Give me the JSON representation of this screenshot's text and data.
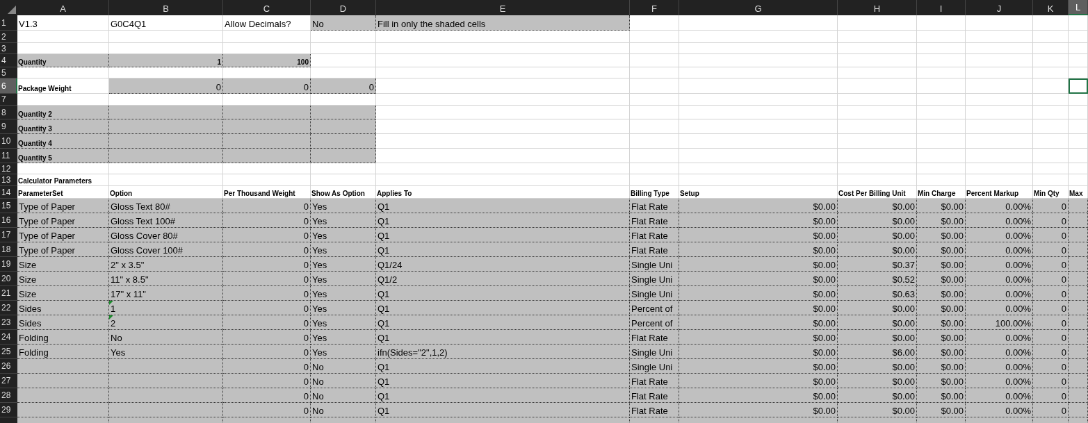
{
  "columns": [
    {
      "label": "A",
      "selected": false
    },
    {
      "label": "B",
      "selected": false
    },
    {
      "label": "C",
      "selected": false
    },
    {
      "label": "D",
      "selected": false
    },
    {
      "label": "E",
      "selected": false
    },
    {
      "label": "F",
      "selected": false
    },
    {
      "label": "G",
      "selected": false
    },
    {
      "label": "H",
      "selected": false
    },
    {
      "label": "I",
      "selected": false
    },
    {
      "label": "J",
      "selected": false
    },
    {
      "label": "K",
      "selected": false
    },
    {
      "label": "L",
      "selected": true
    }
  ],
  "rows": [
    {
      "number": "1",
      "selected": false,
      "cells": [
        {
          "text": "V1.3",
          "kind": "text",
          "shaded": false
        },
        {
          "text": "G0C4Q1",
          "kind": "text",
          "shaded": false,
          "flagged": false
        },
        {
          "text": "Allow Decimals?",
          "kind": "text",
          "shaded": false
        },
        {
          "text": "No",
          "kind": "text",
          "shaded": true
        },
        {
          "text": "Fill in only the shaded cells",
          "kind": "text",
          "shaded": true
        },
        {
          "shaded": false
        },
        {
          "shaded": false
        },
        {
          "shaded": false
        },
        {
          "shaded": false
        },
        {
          "shaded": false
        },
        {
          "shaded": false
        },
        {
          "shaded": false
        }
      ]
    },
    {
      "number": "2",
      "selected": false,
      "cells": [
        {
          "shaded": false
        },
        {
          "shaded": false
        },
        {
          "shaded": false
        },
        {
          "shaded": false
        },
        {
          "shaded": false
        },
        {
          "shaded": false
        },
        {
          "shaded": false
        },
        {
          "shaded": false
        },
        {
          "shaded": false
        },
        {
          "shaded": false
        },
        {
          "shaded": false
        },
        {
          "shaded": false
        }
      ]
    },
    {
      "number": "3",
      "selected": false,
      "cells": [
        {
          "shaded": false
        },
        {
          "shaded": false
        },
        {
          "shaded": false
        },
        {
          "shaded": false
        },
        {
          "shaded": false
        },
        {
          "shaded": false
        },
        {
          "shaded": false
        },
        {
          "shaded": false
        },
        {
          "shaded": false
        },
        {
          "shaded": false
        },
        {
          "shaded": false
        },
        {
          "shaded": false
        }
      ]
    },
    {
      "number": "4",
      "selected": false,
      "cells": [
        {
          "text": "Quantity",
          "kind": "label",
          "shaded": true
        },
        {
          "text": "1",
          "kind": "label-number",
          "shaded": true,
          "flagged": false
        },
        {
          "text": "100",
          "kind": "label-number",
          "shaded": true
        },
        {
          "shaded": false
        },
        {
          "shaded": false
        },
        {
          "shaded": false
        },
        {
          "shaded": false
        },
        {
          "shaded": false
        },
        {
          "shaded": false
        },
        {
          "shaded": false
        },
        {
          "shaded": false
        },
        {
          "shaded": false
        }
      ]
    },
    {
      "number": "5",
      "selected": false,
      "cells": [
        {
          "shaded": false
        },
        {
          "shaded": false
        },
        {
          "shaded": false
        },
        {
          "shaded": false
        },
        {
          "shaded": false
        },
        {
          "shaded": false
        },
        {
          "shaded": false
        },
        {
          "shaded": false
        },
        {
          "shaded": false
        },
        {
          "shaded": false
        },
        {
          "shaded": false
        },
        {
          "shaded": false
        }
      ]
    },
    {
      "number": "6",
      "selected": true,
      "cells": [
        {
          "text": "Package Weight",
          "kind": "label",
          "shaded": false
        },
        {
          "text": "0",
          "kind": "number",
          "shaded": true,
          "flagged": false
        },
        {
          "text": "0",
          "kind": "number",
          "shaded": true
        },
        {
          "text": "0",
          "kind": "number",
          "shaded": true
        },
        {
          "shaded": false
        },
        {
          "shaded": false
        },
        {
          "shaded": false
        },
        {
          "shaded": false
        },
        {
          "shaded": false
        },
        {
          "shaded": false
        },
        {
          "shaded": false
        },
        {
          "shaded": false
        }
      ]
    },
    {
      "number": "7",
      "selected": false,
      "cells": [
        {
          "shaded": false
        },
        {
          "shaded": false
        },
        {
          "shaded": false
        },
        {
          "shaded": false
        },
        {
          "shaded": false
        },
        {
          "shaded": false
        },
        {
          "shaded": false
        },
        {
          "shaded": false
        },
        {
          "shaded": false
        },
        {
          "shaded": false
        },
        {
          "shaded": false
        },
        {
          "shaded": false
        }
      ]
    },
    {
      "number": "8",
      "selected": false,
      "cells": [
        {
          "text": "Quantity 2",
          "kind": "label",
          "shaded": true
        },
        {
          "shaded": true
        },
        {
          "shaded": true
        },
        {
          "shaded": true
        },
        {
          "shaded": false
        },
        {
          "shaded": false
        },
        {
          "shaded": false
        },
        {
          "shaded": false
        },
        {
          "shaded": false
        },
        {
          "shaded": false
        },
        {
          "shaded": false
        },
        {
          "shaded": false
        }
      ]
    },
    {
      "number": "9",
      "selected": false,
      "cells": [
        {
          "text": "Quantity 3",
          "kind": "label",
          "shaded": true
        },
        {
          "shaded": true
        },
        {
          "shaded": true
        },
        {
          "shaded": true
        },
        {
          "shaded": false
        },
        {
          "shaded": false
        },
        {
          "shaded": false
        },
        {
          "shaded": false
        },
        {
          "shaded": false
        },
        {
          "shaded": false
        },
        {
          "shaded": false
        },
        {
          "shaded": false
        }
      ]
    },
    {
      "number": "10",
      "selected": false,
      "cells": [
        {
          "text": "Quantity 4",
          "kind": "label",
          "shaded": true
        },
        {
          "shaded": true
        },
        {
          "shaded": true
        },
        {
          "shaded": true
        },
        {
          "shaded": false
        },
        {
          "shaded": false
        },
        {
          "shaded": false
        },
        {
          "shaded": false
        },
        {
          "shaded": false
        },
        {
          "shaded": false
        },
        {
          "shaded": false
        },
        {
          "shaded": false
        }
      ]
    },
    {
      "number": "11",
      "selected": false,
      "cells": [
        {
          "text": "Quantity 5",
          "kind": "label",
          "shaded": true
        },
        {
          "shaded": true
        },
        {
          "shaded": true
        },
        {
          "shaded": true
        },
        {
          "shaded": false
        },
        {
          "shaded": false
        },
        {
          "shaded": false
        },
        {
          "shaded": false
        },
        {
          "shaded": false
        },
        {
          "shaded": false
        },
        {
          "shaded": false
        },
        {
          "shaded": false
        }
      ]
    },
    {
      "number": "12",
      "selected": false,
      "cells": [
        {
          "shaded": false
        },
        {
          "shaded": false
        },
        {
          "shaded": false
        },
        {
          "shaded": false
        },
        {
          "shaded": false
        },
        {
          "shaded": false
        },
        {
          "shaded": false
        },
        {
          "shaded": false
        },
        {
          "shaded": false
        },
        {
          "shaded": false
        },
        {
          "shaded": false
        },
        {
          "shaded": false
        }
      ]
    },
    {
      "number": "13",
      "selected": false,
      "cells": [
        {
          "text": "Calculator Parameters",
          "kind": "label",
          "shaded": false
        },
        {
          "shaded": false
        },
        {
          "shaded": false
        },
        {
          "shaded": false
        },
        {
          "shaded": false
        },
        {
          "shaded": false
        },
        {
          "shaded": false
        },
        {
          "shaded": false
        },
        {
          "shaded": false
        },
        {
          "shaded": false
        },
        {
          "shaded": false
        },
        {
          "shaded": false
        }
      ]
    },
    {
      "number": "14",
      "selected": false,
      "cells": [
        {
          "text": "ParameterSet",
          "kind": "label",
          "shaded": false
        },
        {
          "text": "Option",
          "kind": "label",
          "shaded": false,
          "flagged": false
        },
        {
          "text": "Per Thousand Weight",
          "kind": "label",
          "shaded": false
        },
        {
          "text": "Show As Option",
          "kind": "label",
          "shaded": false
        },
        {
          "text": "Applies To",
          "kind": "label",
          "shaded": false
        },
        {
          "text": "Billing Type",
          "kind": "label",
          "shaded": false
        },
        {
          "text": "Setup",
          "kind": "label",
          "shaded": false
        },
        {
          "text": "Cost Per Billing Unit",
          "kind": "label",
          "shaded": false
        },
        {
          "text": "Min Charge",
          "kind": "label",
          "shaded": false
        },
        {
          "text": "Percent Markup",
          "kind": "label",
          "shaded": false
        },
        {
          "text": "Min Qty",
          "kind": "label",
          "shaded": false
        },
        {
          "text": "Max",
          "kind": "label",
          "shaded": false
        }
      ]
    },
    {
      "number": "15",
      "selected": false,
      "cells": [
        {
          "text": "Type of Paper",
          "kind": "text",
          "shaded": true
        },
        {
          "text": "Gloss Text 80#",
          "kind": "text",
          "shaded": true,
          "flagged": false
        },
        {
          "text": "0",
          "kind": "number",
          "shaded": true
        },
        {
          "text": "Yes",
          "kind": "text",
          "shaded": true
        },
        {
          "text": "Q1",
          "kind": "text",
          "shaded": true
        },
        {
          "text": "Flat Rate",
          "kind": "text",
          "shaded": true
        },
        {
          "text": "$0.00",
          "kind": "number",
          "shaded": true
        },
        {
          "text": "$0.00",
          "kind": "number",
          "shaded": true
        },
        {
          "text": "$0.00",
          "kind": "number",
          "shaded": true
        },
        {
          "text": "0.00%",
          "kind": "number",
          "shaded": true
        },
        {
          "text": "0",
          "kind": "number",
          "shaded": true
        },
        {
          "shaded": true
        }
      ]
    },
    {
      "number": "16",
      "selected": false,
      "cells": [
        {
          "text": "Type of Paper",
          "kind": "text",
          "shaded": true
        },
        {
          "text": "Gloss Text 100#",
          "kind": "text",
          "shaded": true,
          "flagged": false
        },
        {
          "text": "0",
          "kind": "number",
          "shaded": true
        },
        {
          "text": "Yes",
          "kind": "text",
          "shaded": true
        },
        {
          "text": "Q1",
          "kind": "text",
          "shaded": true
        },
        {
          "text": "Flat Rate",
          "kind": "text",
          "shaded": true
        },
        {
          "text": "$0.00",
          "kind": "number",
          "shaded": true
        },
        {
          "text": "$0.00",
          "kind": "number",
          "shaded": true
        },
        {
          "text": "$0.00",
          "kind": "number",
          "shaded": true
        },
        {
          "text": "0.00%",
          "kind": "number",
          "shaded": true
        },
        {
          "text": "0",
          "kind": "number",
          "shaded": true
        },
        {
          "shaded": true
        }
      ]
    },
    {
      "number": "17",
      "selected": false,
      "cells": [
        {
          "text": "Type of Paper",
          "kind": "text",
          "shaded": true
        },
        {
          "text": "Gloss Cover 80#",
          "kind": "text",
          "shaded": true,
          "flagged": false
        },
        {
          "text": "0",
          "kind": "number",
          "shaded": true
        },
        {
          "text": "Yes",
          "kind": "text",
          "shaded": true
        },
        {
          "text": "Q1",
          "kind": "text",
          "shaded": true
        },
        {
          "text": "Flat Rate",
          "kind": "text",
          "shaded": true
        },
        {
          "text": "$0.00",
          "kind": "number",
          "shaded": true
        },
        {
          "text": "$0.00",
          "kind": "number",
          "shaded": true
        },
        {
          "text": "$0.00",
          "kind": "number",
          "shaded": true
        },
        {
          "text": "0.00%",
          "kind": "number",
          "shaded": true
        },
        {
          "text": "0",
          "kind": "number",
          "shaded": true
        },
        {
          "shaded": true
        }
      ]
    },
    {
      "number": "18",
      "selected": false,
      "cells": [
        {
          "text": "Type of Paper",
          "kind": "text",
          "shaded": true
        },
        {
          "text": "Gloss Cover 100#",
          "kind": "text",
          "shaded": true,
          "flagged": false
        },
        {
          "text": "0",
          "kind": "number",
          "shaded": true
        },
        {
          "text": "Yes",
          "kind": "text",
          "shaded": true
        },
        {
          "text": "Q1",
          "kind": "text",
          "shaded": true
        },
        {
          "text": "Flat Rate",
          "kind": "text",
          "shaded": true
        },
        {
          "text": "$0.00",
          "kind": "number",
          "shaded": true
        },
        {
          "text": "$0.00",
          "kind": "number",
          "shaded": true
        },
        {
          "text": "$0.00",
          "kind": "number",
          "shaded": true
        },
        {
          "text": "0.00%",
          "kind": "number",
          "shaded": true
        },
        {
          "text": "0",
          "kind": "number",
          "shaded": true
        },
        {
          "shaded": true
        }
      ]
    },
    {
      "number": "19",
      "selected": false,
      "cells": [
        {
          "text": "Size",
          "kind": "text",
          "shaded": true
        },
        {
          "text": "2\" x 3.5\"",
          "kind": "text",
          "shaded": true,
          "flagged": false
        },
        {
          "text": "0",
          "kind": "number",
          "shaded": true
        },
        {
          "text": "Yes",
          "kind": "text",
          "shaded": true
        },
        {
          "text": "Q1/24",
          "kind": "text",
          "shaded": true
        },
        {
          "text": "Single Uni",
          "kind": "text",
          "shaded": true
        },
        {
          "text": "$0.00",
          "kind": "number",
          "shaded": true
        },
        {
          "text": "$0.37",
          "kind": "number",
          "shaded": true
        },
        {
          "text": "$0.00",
          "kind": "number",
          "shaded": true
        },
        {
          "text": "0.00%",
          "kind": "number",
          "shaded": true
        },
        {
          "text": "0",
          "kind": "number",
          "shaded": true
        },
        {
          "shaded": true
        }
      ]
    },
    {
      "number": "20",
      "selected": false,
      "cells": [
        {
          "text": "Size",
          "kind": "text",
          "shaded": true
        },
        {
          "text": "11\" x 8.5\"",
          "kind": "text",
          "shaded": true,
          "flagged": false
        },
        {
          "text": "0",
          "kind": "number",
          "shaded": true
        },
        {
          "text": "Yes",
          "kind": "text",
          "shaded": true
        },
        {
          "text": "Q1/2",
          "kind": "text",
          "shaded": true
        },
        {
          "text": "Single Uni",
          "kind": "text",
          "shaded": true
        },
        {
          "text": "$0.00",
          "kind": "number",
          "shaded": true
        },
        {
          "text": "$0.52",
          "kind": "number",
          "shaded": true
        },
        {
          "text": "$0.00",
          "kind": "number",
          "shaded": true
        },
        {
          "text": "0.00%",
          "kind": "number",
          "shaded": true
        },
        {
          "text": "0",
          "kind": "number",
          "shaded": true
        },
        {
          "shaded": true
        }
      ]
    },
    {
      "number": "21",
      "selected": false,
      "cells": [
        {
          "text": "Size",
          "kind": "text",
          "shaded": true
        },
        {
          "text": "17\" x 11\"",
          "kind": "text",
          "shaded": true,
          "flagged": false
        },
        {
          "text": "0",
          "kind": "number",
          "shaded": true
        },
        {
          "text": "Yes",
          "kind": "text",
          "shaded": true
        },
        {
          "text": "Q1",
          "kind": "text",
          "shaded": true
        },
        {
          "text": "Single Uni",
          "kind": "text",
          "shaded": true
        },
        {
          "text": "$0.00",
          "kind": "number",
          "shaded": true
        },
        {
          "text": "$0.63",
          "kind": "number",
          "shaded": true
        },
        {
          "text": "$0.00",
          "kind": "number",
          "shaded": true
        },
        {
          "text": "0.00%",
          "kind": "number",
          "shaded": true
        },
        {
          "text": "0",
          "kind": "number",
          "shaded": true
        },
        {
          "shaded": true
        }
      ]
    },
    {
      "number": "22",
      "selected": false,
      "cells": [
        {
          "text": "Sides",
          "kind": "text",
          "shaded": true
        },
        {
          "text": "1",
          "kind": "text",
          "shaded": true,
          "flagged": true
        },
        {
          "text": "0",
          "kind": "number",
          "shaded": true
        },
        {
          "text": "Yes",
          "kind": "text",
          "shaded": true
        },
        {
          "text": "Q1",
          "kind": "text",
          "shaded": true
        },
        {
          "text": "Percent of",
          "kind": "text",
          "shaded": true
        },
        {
          "text": "$0.00",
          "kind": "number",
          "shaded": true
        },
        {
          "text": "$0.00",
          "kind": "number",
          "shaded": true
        },
        {
          "text": "$0.00",
          "kind": "number",
          "shaded": true
        },
        {
          "text": "0.00%",
          "kind": "number",
          "shaded": true
        },
        {
          "text": "0",
          "kind": "number",
          "shaded": true
        },
        {
          "shaded": true
        }
      ]
    },
    {
      "number": "23",
      "selected": false,
      "cells": [
        {
          "text": "Sides",
          "kind": "text",
          "shaded": true
        },
        {
          "text": "2",
          "kind": "text",
          "shaded": true,
          "flagged": true
        },
        {
          "text": "0",
          "kind": "number",
          "shaded": true
        },
        {
          "text": "Yes",
          "kind": "text",
          "shaded": true
        },
        {
          "text": "Q1",
          "kind": "text",
          "shaded": true
        },
        {
          "text": "Percent of",
          "kind": "text",
          "shaded": true
        },
        {
          "text": "$0.00",
          "kind": "number",
          "shaded": true
        },
        {
          "text": "$0.00",
          "kind": "number",
          "shaded": true
        },
        {
          "text": "$0.00",
          "kind": "number",
          "shaded": true
        },
        {
          "text": "100.00%",
          "kind": "number",
          "shaded": true
        },
        {
          "text": "0",
          "kind": "number",
          "shaded": true
        },
        {
          "shaded": true
        }
      ]
    },
    {
      "number": "24",
      "selected": false,
      "cells": [
        {
          "text": "Folding",
          "kind": "text",
          "shaded": true
        },
        {
          "text": "No",
          "kind": "text",
          "shaded": true,
          "flagged": false
        },
        {
          "text": "0",
          "kind": "number",
          "shaded": true
        },
        {
          "text": "Yes",
          "kind": "text",
          "shaded": true
        },
        {
          "text": "Q1",
          "kind": "text",
          "shaded": true
        },
        {
          "text": "Flat Rate",
          "kind": "text",
          "shaded": true
        },
        {
          "text": "$0.00",
          "kind": "number",
          "shaded": true
        },
        {
          "text": "$0.00",
          "kind": "number",
          "shaded": true
        },
        {
          "text": "$0.00",
          "kind": "number",
          "shaded": true
        },
        {
          "text": "0.00%",
          "kind": "number",
          "shaded": true
        },
        {
          "text": "0",
          "kind": "number",
          "shaded": true
        },
        {
          "shaded": true
        }
      ]
    },
    {
      "number": "25",
      "selected": false,
      "cells": [
        {
          "text": "Folding",
          "kind": "text",
          "shaded": true
        },
        {
          "text": "Yes",
          "kind": "text",
          "shaded": true,
          "flagged": false
        },
        {
          "text": "0",
          "kind": "number",
          "shaded": true
        },
        {
          "text": "Yes",
          "kind": "text",
          "shaded": true
        },
        {
          "text": "ifn(Sides=\"2\",1,2)",
          "kind": "text",
          "shaded": true
        },
        {
          "text": "Single Uni",
          "kind": "text",
          "shaded": true
        },
        {
          "text": "$0.00",
          "kind": "number",
          "shaded": true
        },
        {
          "text": "$6.00",
          "kind": "number",
          "shaded": true
        },
        {
          "text": "$0.00",
          "kind": "number",
          "shaded": true
        },
        {
          "text": "0.00%",
          "kind": "number",
          "shaded": true
        },
        {
          "text": "0",
          "kind": "number",
          "shaded": true
        },
        {
          "shaded": true
        }
      ]
    },
    {
      "number": "26",
      "selected": false,
      "cells": [
        {
          "shaded": true
        },
        {
          "shaded": true
        },
        {
          "text": "0",
          "kind": "number",
          "shaded": true
        },
        {
          "text": "No",
          "kind": "text",
          "shaded": true
        },
        {
          "text": "Q1",
          "kind": "text",
          "shaded": true
        },
        {
          "text": "Single Uni",
          "kind": "text",
          "shaded": true
        },
        {
          "text": "$0.00",
          "kind": "number",
          "shaded": true
        },
        {
          "text": "$0.00",
          "kind": "number",
          "shaded": true
        },
        {
          "text": "$0.00",
          "kind": "number",
          "shaded": true
        },
        {
          "text": "0.00%",
          "kind": "number",
          "shaded": true
        },
        {
          "text": "0",
          "kind": "number",
          "shaded": true
        },
        {
          "shaded": true
        }
      ]
    },
    {
      "number": "27",
      "selected": false,
      "cells": [
        {
          "shaded": true
        },
        {
          "shaded": true
        },
        {
          "text": "0",
          "kind": "number",
          "shaded": true
        },
        {
          "text": "No",
          "kind": "text",
          "shaded": true
        },
        {
          "text": "Q1",
          "kind": "text",
          "shaded": true
        },
        {
          "text": "Flat Rate",
          "kind": "text",
          "shaded": true
        },
        {
          "text": "$0.00",
          "kind": "number",
          "shaded": true
        },
        {
          "text": "$0.00",
          "kind": "number",
          "shaded": true
        },
        {
          "text": "$0.00",
          "kind": "number",
          "shaded": true
        },
        {
          "text": "0.00%",
          "kind": "number",
          "shaded": true
        },
        {
          "text": "0",
          "kind": "number",
          "shaded": true
        },
        {
          "shaded": true
        }
      ]
    },
    {
      "number": "28",
      "selected": false,
      "cells": [
        {
          "shaded": true
        },
        {
          "shaded": true
        },
        {
          "text": "0",
          "kind": "number",
          "shaded": true
        },
        {
          "text": "No",
          "kind": "text",
          "shaded": true
        },
        {
          "text": "Q1",
          "kind": "text",
          "shaded": true
        },
        {
          "text": "Flat Rate",
          "kind": "text",
          "shaded": true
        },
        {
          "text": "$0.00",
          "kind": "number",
          "shaded": true
        },
        {
          "text": "$0.00",
          "kind": "number",
          "shaded": true
        },
        {
          "text": "$0.00",
          "kind": "number",
          "shaded": true
        },
        {
          "text": "0.00%",
          "kind": "number",
          "shaded": true
        },
        {
          "text": "0",
          "kind": "number",
          "shaded": true
        },
        {
          "shaded": true
        }
      ]
    },
    {
      "number": "29",
      "selected": false,
      "cells": [
        {
          "shaded": true
        },
        {
          "shaded": true
        },
        {
          "text": "0",
          "kind": "number",
          "shaded": true
        },
        {
          "text": "No",
          "kind": "text",
          "shaded": true
        },
        {
          "text": "Q1",
          "kind": "text",
          "shaded": true
        },
        {
          "text": "Flat Rate",
          "kind": "text",
          "shaded": true
        },
        {
          "text": "$0.00",
          "kind": "number",
          "shaded": true
        },
        {
          "text": "$0.00",
          "kind": "number",
          "shaded": true
        },
        {
          "text": "$0.00",
          "kind": "number",
          "shaded": true
        },
        {
          "text": "0.00%",
          "kind": "number",
          "shaded": true
        },
        {
          "text": "0",
          "kind": "number",
          "shaded": true
        },
        {
          "shaded": true
        }
      ]
    },
    {
      "selected": false,
      "cells": [
        {
          "shaded": true
        },
        {
          "shaded": true
        },
        {
          "shaded": true
        },
        {
          "shaded": true
        },
        {
          "shaded": true
        },
        {
          "shaded": true
        },
        {
          "shaded": true
        },
        {
          "shaded": true
        },
        {
          "shaded": true
        },
        {
          "shaded": true
        },
        {
          "shaded": true
        },
        {
          "shaded": true
        }
      ]
    }
  ]
}
